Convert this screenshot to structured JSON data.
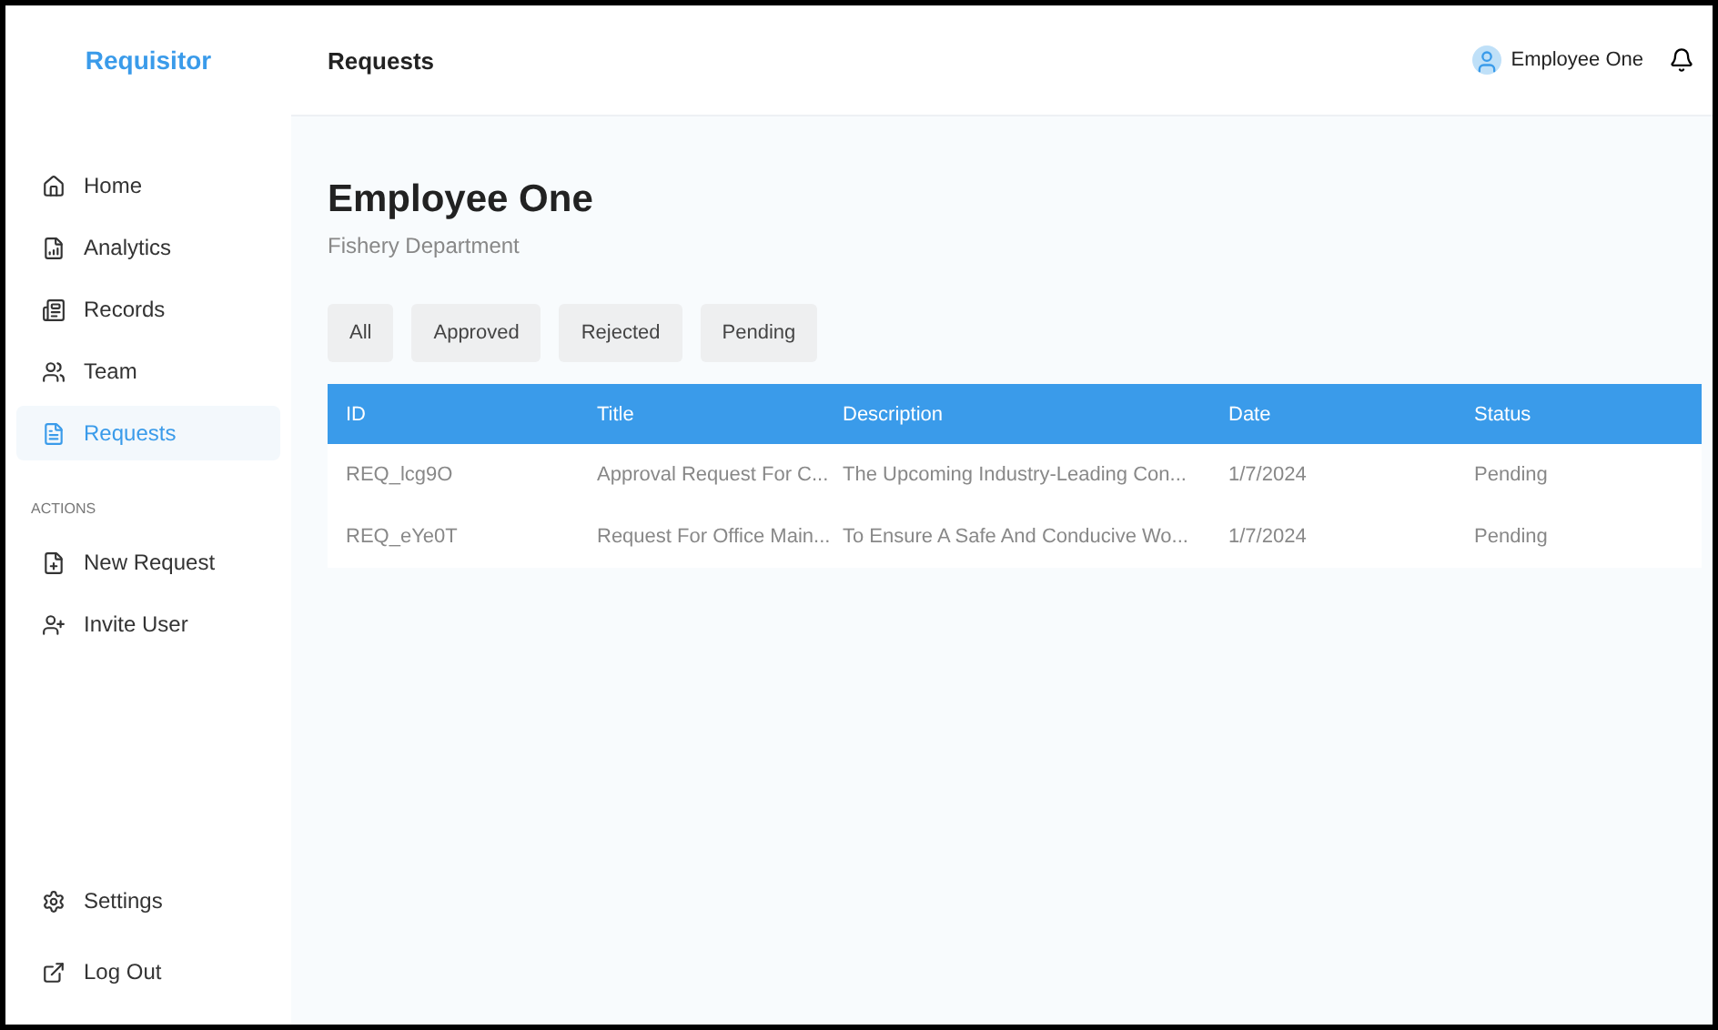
{
  "sidebar": {
    "brand": "Requisitor",
    "nav": [
      {
        "label": "Home",
        "selected": false
      },
      {
        "label": "Analytics",
        "selected": false
      },
      {
        "label": "Records",
        "selected": false
      },
      {
        "label": "Team",
        "selected": false
      },
      {
        "label": "Requests",
        "selected": true
      }
    ],
    "actions_heading": "ACTIONS",
    "actions": [
      {
        "label": "New Request"
      },
      {
        "label": "Invite User"
      }
    ],
    "bottom": [
      {
        "label": "Settings"
      },
      {
        "label": "Log Out"
      }
    ]
  },
  "header": {
    "title": "Requests",
    "user": "Employee One"
  },
  "profile": {
    "name": "Employee One",
    "department": "Fishery Department"
  },
  "filters": [
    {
      "label": "All",
      "selected": false
    },
    {
      "label": "Approved",
      "selected": false
    },
    {
      "label": "Rejected",
      "selected": false
    },
    {
      "label": "Pending",
      "selected": false
    }
  ],
  "table": {
    "columns": [
      "ID",
      "Title",
      "Description",
      "Date",
      "Status"
    ],
    "rows": [
      [
        "REQ_lcg9O",
        "Approval Request For C...",
        "The Upcoming Industry-Leading Con...",
        "1/7/2024",
        "Pending"
      ],
      [
        "REQ_eYe0T",
        "Request For Office Main...",
        "To Ensure A Safe And Conducive Wo...",
        "1/7/2024",
        "Pending"
      ]
    ]
  }
}
